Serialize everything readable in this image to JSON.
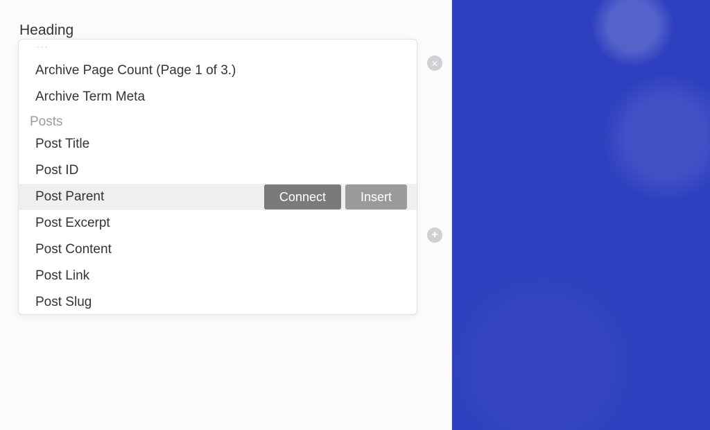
{
  "field_label": "Heading",
  "dropdown": {
    "partially_visible_above": "…",
    "archive_items": [
      "Archive Page Count (Page 1 of 3.)",
      "Archive Term Meta"
    ],
    "group_label": "Posts",
    "posts_items": [
      "Post Title",
      "Post ID",
      "Post Parent",
      "Post Excerpt",
      "Post Content",
      "Post Link",
      "Post Slug"
    ],
    "active_item_index": 2,
    "actions": {
      "connect_label": "Connect",
      "insert_label": "Insert"
    }
  },
  "icon_buttons": {
    "close": "close-icon",
    "add": "plus-icon"
  }
}
